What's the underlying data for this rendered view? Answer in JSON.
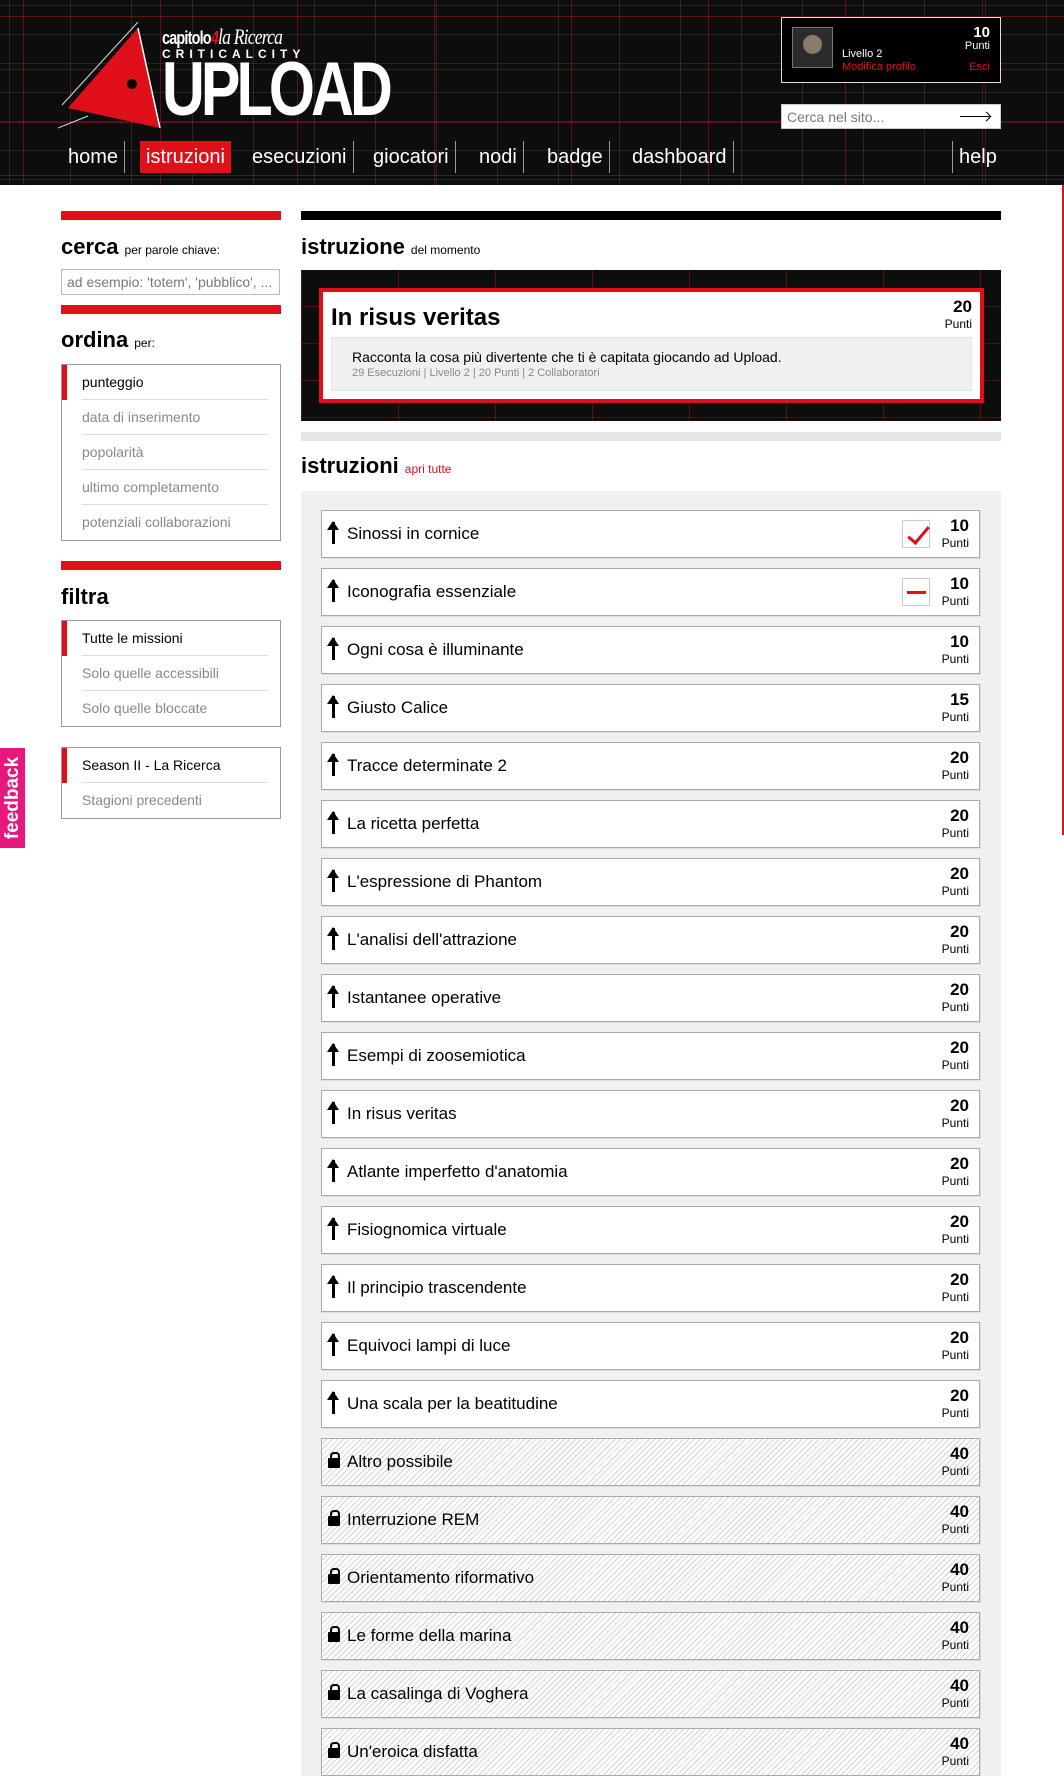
{
  "header": {
    "logo": {
      "capitolo": "capitolo",
      "num": "4",
      "ricerca": "la Ricerca",
      "sub": "CRITICALCITY",
      "big": "UPLOAD"
    },
    "user": {
      "level": "Livello 2",
      "edit_profile": "Modifica profilo",
      "points_value": "10",
      "points_label": "Punti",
      "logout": "Esci"
    },
    "search": {
      "placeholder": "Cerca nel sito..."
    },
    "nav": [
      "home",
      "istruzioni",
      "esecuzioni",
      "giocatori",
      "nodi",
      "badge",
      "dashboard"
    ],
    "help": "help"
  },
  "sidebar": {
    "search": {
      "title": "cerca",
      "subtitle": "per parole chiave:",
      "placeholder": "ad esempio: 'totem', 'pubblico', ..."
    },
    "sort": {
      "title": "ordina",
      "subtitle": "per:",
      "options": [
        "punteggio",
        "data di inserimento",
        "popolarità",
        "ultimo completamento",
        "potenziali collaborazioni"
      ]
    },
    "filter": {
      "title": "filtra",
      "options": [
        "Tutte le missioni",
        "Solo quelle accessibili",
        "Solo quelle bloccate"
      ]
    },
    "season": {
      "options": [
        "Season II - La Ricerca",
        "Stagioni precedenti"
      ]
    },
    "feedback": "feedback"
  },
  "main": {
    "featured_section": {
      "title": "istruzione",
      "subtitle": "del momento"
    },
    "featured": {
      "title": "In risus veritas",
      "points_value": "20",
      "points_label": "Punti",
      "description": "Racconta la cosa più divertente che ti è capitata giocando ad Upload.",
      "meta": "29 Esecuzioni | Livello 2 | 20 Punti | 2 Collaboratori"
    },
    "list_section": {
      "title": "istruzioni",
      "open_all": "apri tutte"
    },
    "points_label": "Punti",
    "items": [
      {
        "title": "Sinossi in cornice",
        "points": "10",
        "locked": false,
        "status": "check"
      },
      {
        "title": "Iconografia essenziale",
        "points": "10",
        "locked": false,
        "status": "dash"
      },
      {
        "title": "Ogni cosa è illuminante",
        "points": "10",
        "locked": false,
        "status": ""
      },
      {
        "title": "Giusto Calice",
        "points": "15",
        "locked": false,
        "status": ""
      },
      {
        "title": "Tracce determinate 2",
        "points": "20",
        "locked": false,
        "status": ""
      },
      {
        "title": "La ricetta perfetta",
        "points": "20",
        "locked": false,
        "status": ""
      },
      {
        "title": "L'espressione di Phantom",
        "points": "20",
        "locked": false,
        "status": ""
      },
      {
        "title": "L'analisi dell'attrazione",
        "points": "20",
        "locked": false,
        "status": ""
      },
      {
        "title": "Istantanee operative",
        "points": "20",
        "locked": false,
        "status": ""
      },
      {
        "title": "Esempi di zoosemiotica",
        "points": "20",
        "locked": false,
        "status": ""
      },
      {
        "title": "In risus veritas",
        "points": "20",
        "locked": false,
        "status": ""
      },
      {
        "title": "Atlante imperfetto d'anatomia",
        "points": "20",
        "locked": false,
        "status": ""
      },
      {
        "title": "Fisiognomica virtuale",
        "points": "20",
        "locked": false,
        "status": ""
      },
      {
        "title": "Il principio trascendente",
        "points": "20",
        "locked": false,
        "status": ""
      },
      {
        "title": "Equivoci lampi di luce",
        "points": "20",
        "locked": false,
        "status": ""
      },
      {
        "title": "Una scala per la beatitudine",
        "points": "20",
        "locked": false,
        "status": ""
      },
      {
        "title": "Altro possibile",
        "points": "40",
        "locked": true,
        "status": ""
      },
      {
        "title": "Interruzione REM",
        "points": "40",
        "locked": true,
        "status": ""
      },
      {
        "title": "Orientamento riformativo",
        "points": "40",
        "locked": true,
        "status": ""
      },
      {
        "title": "Le forme della marina",
        "points": "40",
        "locked": true,
        "status": ""
      },
      {
        "title": "La casalinga di Voghera",
        "points": "40",
        "locked": true,
        "status": ""
      },
      {
        "title": "Un'eroica disfatta",
        "points": "40",
        "locked": true,
        "status": ""
      }
    ]
  },
  "colors": {
    "accent": "#e0101a",
    "header_bg": "#0d0d0d",
    "feedback": "#e8177d",
    "list_bg": "#f0f0f0"
  }
}
